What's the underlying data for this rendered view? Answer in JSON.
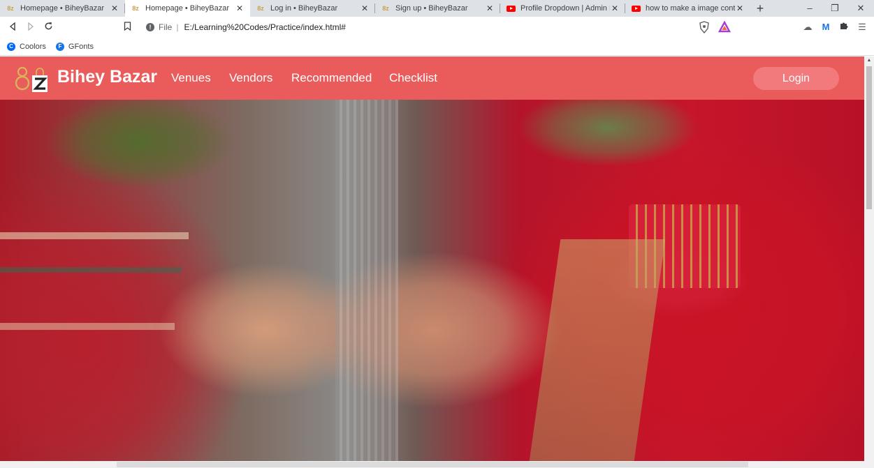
{
  "browser": {
    "tabs": [
      {
        "title": "Homepage • BiheyBazar",
        "favicon": "biheybazar-logo",
        "active": false
      },
      {
        "title": "Homepage • BiheyBazar",
        "favicon": "biheybazar-logo",
        "active": true
      },
      {
        "title": "Log in • BiheyBazar",
        "favicon": "biheybazar-logo",
        "active": false
      },
      {
        "title": "Sign up • BiheyBazar",
        "favicon": "biheybazar-logo",
        "active": false
      },
      {
        "title": "Profile Dropdown | Admin Pan",
        "favicon": "youtube-icon",
        "active": false
      },
      {
        "title": "how to make a image containe",
        "favicon": "youtube-icon",
        "active": false
      }
    ],
    "new_tab_label": "+",
    "window_controls": {
      "minimize": "–",
      "restore": "❐",
      "close": "✕"
    },
    "address": {
      "scheme_label": "File",
      "url": "E:/Learning%20Codes/Practice/index.html#"
    },
    "bookmarks": [
      {
        "label": "Coolors",
        "icon": "coolors-icon",
        "color": "#0066ff"
      },
      {
        "label": "GFonts",
        "icon": "google-fonts-icon",
        "color": "#1a73e8"
      }
    ]
  },
  "site": {
    "brand": "Bihey Bazar",
    "nav_links": [
      "Venues",
      "Vendors",
      "Recommended",
      "Checklist"
    ],
    "login_label": "Login",
    "navbar_color": "#ea5c5b",
    "login_color": "#f27a7c",
    "hero_image": "wedding-ring-ceremony-photo",
    "carousel": {
      "slides": 3,
      "active_index": 1
    }
  }
}
